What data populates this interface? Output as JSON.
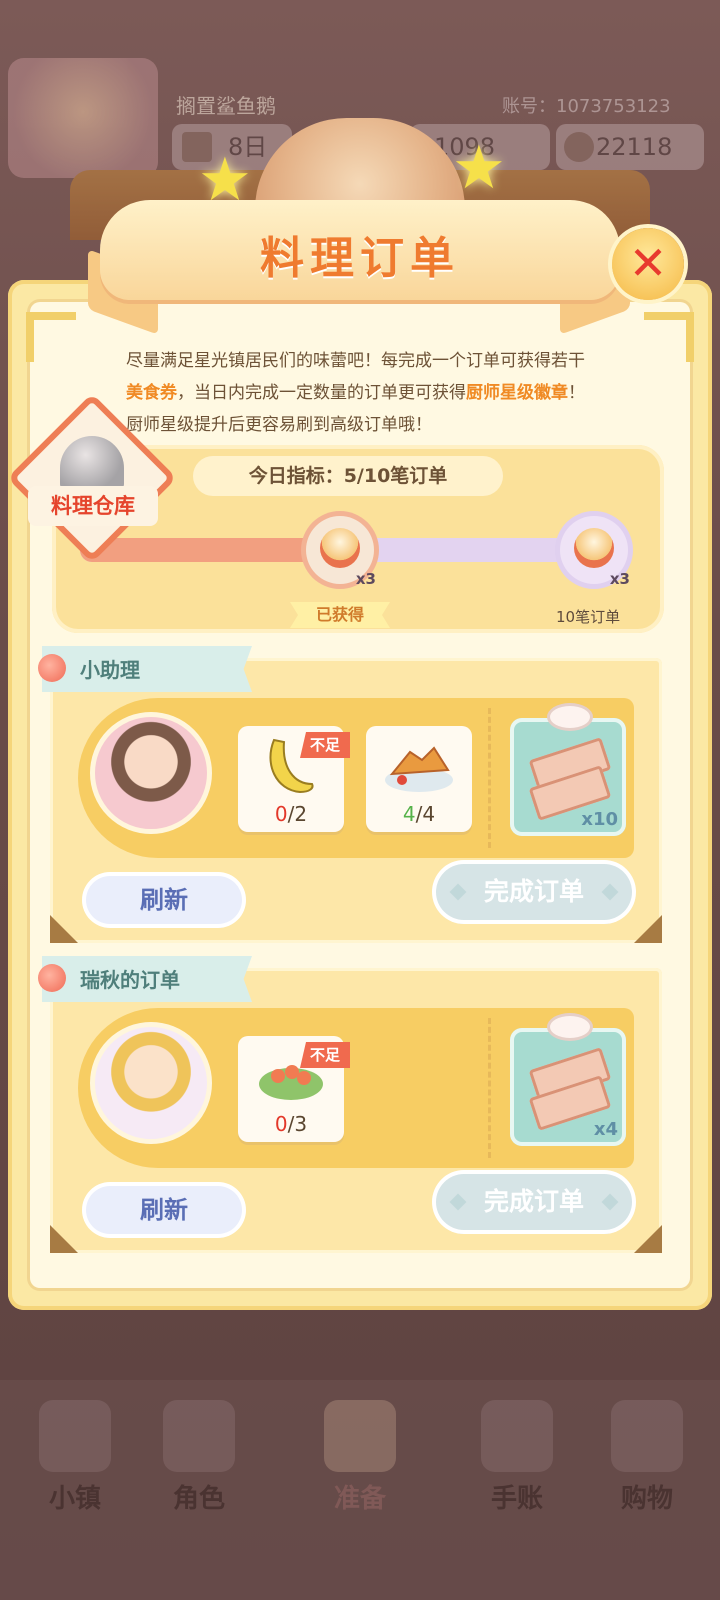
{
  "background_hud": {
    "player_name": "搁置鲨鱼鹅",
    "account": "账号：1073753123",
    "day": "8日",
    "coins": "1098",
    "gems": "22118"
  },
  "bottom_nav": [
    {
      "label": "小镇",
      "icon": "map-icon"
    },
    {
      "label": "角色",
      "icon": "character-icon"
    },
    {
      "label": "准备",
      "icon": "prepare-icon"
    },
    {
      "label": "手账",
      "icon": "journal-icon"
    },
    {
      "label": "购物",
      "icon": "shopping-bag-icon"
    }
  ],
  "dialog": {
    "title": "料理订单",
    "description": {
      "p1": "尽量满足星光镇居民们的味蕾吧！每完成一个订单可获得若干",
      "h1": "美食券",
      "p2": "，当日内完成一定数量的订单更可获得",
      "h2": "厨师星级徽章",
      "p3": "！厨师星级提升后更容易刷到高级订单哦！"
    },
    "warehouse_label": "料理仓库",
    "daily_target": "今日指标：5/10笔订单",
    "progress": {
      "completed": 5,
      "total": 10,
      "milestones": [
        {
          "reward_count": "x3",
          "status_label": "已获得"
        },
        {
          "reward_count": "x3",
          "label": "10笔订单"
        }
      ]
    }
  },
  "orders": [
    {
      "title": "小助理",
      "items": [
        {
          "name": "banana",
          "have": "0",
          "need": "/2",
          "insufficient_label": "不足",
          "sufficient": false
        },
        {
          "name": "fried-dish",
          "have": "4",
          "need": "/4",
          "sufficient": true
        }
      ],
      "reward_qty": "x10",
      "refresh_label": "刷新",
      "complete_label": "完成订单"
    },
    {
      "title": "瑞秋的订单",
      "items": [
        {
          "name": "shrimp-dish",
          "have": "0",
          "need": "/3",
          "insufficient_label": "不足",
          "sufficient": false
        }
      ],
      "reward_qty": "x4",
      "refresh_label": "刷新",
      "complete_label": "完成订单"
    }
  ],
  "colors": {
    "accent_orange": "#ef7b2f",
    "lack_red": "#e3382a",
    "ok_green": "#56b24a",
    "close_red": "#e83a2e"
  }
}
